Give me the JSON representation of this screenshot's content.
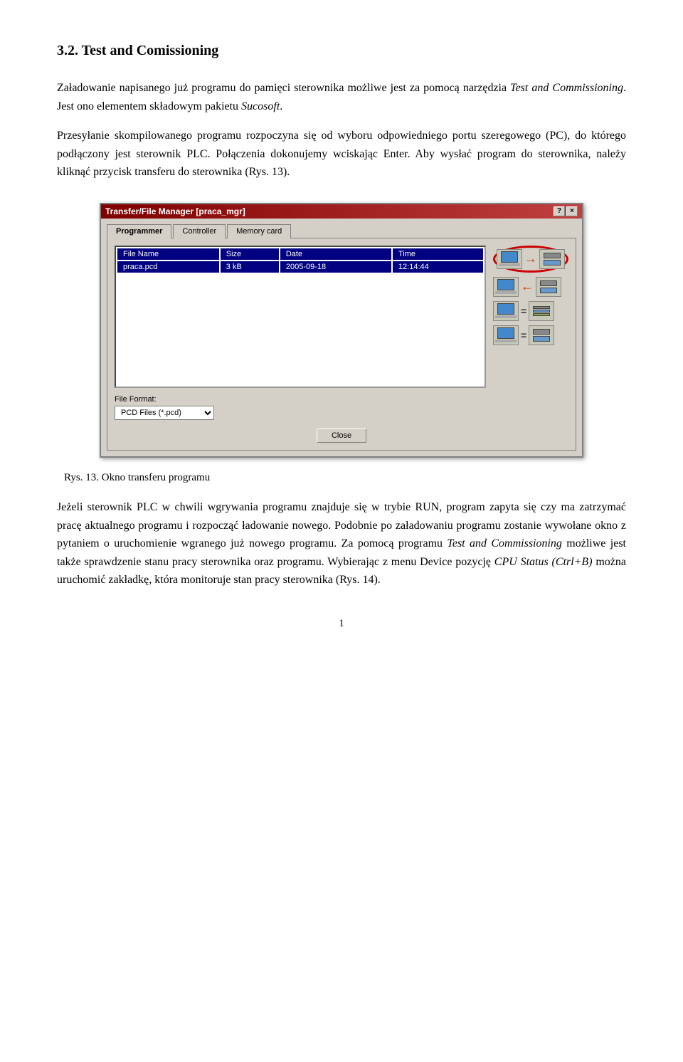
{
  "section": {
    "number": "3.2.",
    "title": "Test and Comissioning"
  },
  "paragraphs": {
    "p1": "Załadowanie napisanego już programu do pamięci sterownika możliwe jest za pomocą narzędzia ",
    "p1_italic": "Test and Commissioning",
    "p1_end": ". Jest ono elementem składowym pakietu ",
    "p1_italic2": "Sucosoft",
    "p1_end2": ".",
    "p2": "Przesyłanie skompilowanego programu rozpoczyna się od wyboru odpowiedniego portu szeregowego (PC), do którego podłączony jest sterownik PLC. Połączenia dokonujemy wciskając Enter. Aby wysłać program do sterownika, należy kliknąć przycisk transferu do sterownika (Rys. 13).",
    "p3_start": "Jeżeli sterownik PLC w chwili wgrywania programu znajduje się w trybie RUN, program zapyta się czy ma zatrzymać pracę aktualnego programu i rozpocząć ładowanie nowego. Podobnie po załadowaniu programu zostanie wywołane okno z pytaniem o uruchomienie wgranego już nowego programu. Za pomocą programu ",
    "p3_italic": "Test and Commissioning",
    "p3_mid": " możliwe jest także sprawdzenie stanu pracy sterownika oraz programu. Wybierając z menu Device pozycję ",
    "p3_italic2": "CPU Status (Ctrl+B)",
    "p3_end": " można uruchomić zakładkę, która monitoruje stan pracy sterownika (Rys. 14)."
  },
  "dialog": {
    "title": "Transfer/File Manager [praca_mgr]",
    "tabs": [
      "Programmer",
      "Controller",
      "Memory card"
    ],
    "active_tab": 0,
    "columns": [
      "File Name",
      "Size",
      "Date",
      "Time"
    ],
    "rows": [
      {
        "name": "praca.pcd",
        "size": "3 kB",
        "date": "2005-09-18",
        "time": "12:14:44"
      }
    ],
    "format_label": "File Format:",
    "format_value": "PCD Files (*.pcd)",
    "close_btn": "Close",
    "help_btn": "?",
    "close_x_btn": "×"
  },
  "caption": "Rys. 13. Okno transferu programu",
  "page_number": "1"
}
